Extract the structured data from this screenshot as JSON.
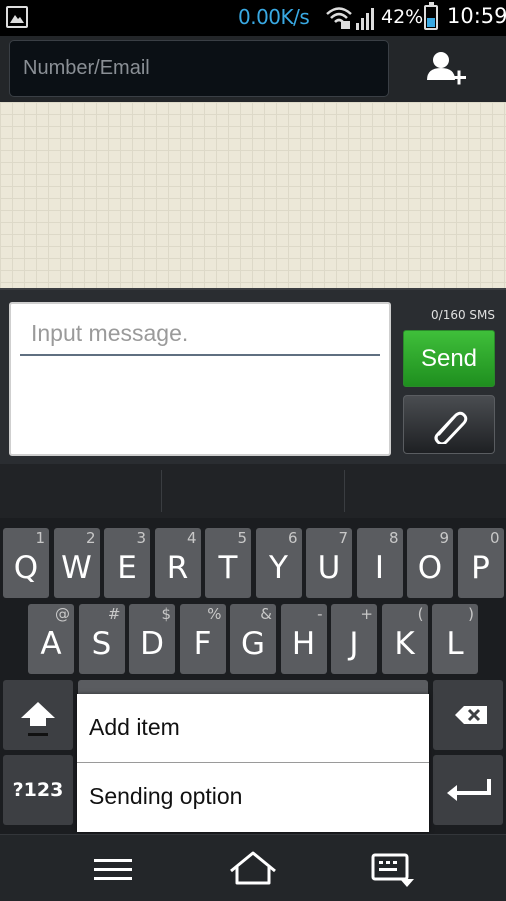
{
  "status_bar": {
    "network_speed": "0.00K/s",
    "battery_percent": "42%",
    "battery_level": 0.42,
    "time": "10:59",
    "icons": [
      "picture-icon",
      "wifi-icon",
      "signal-icon",
      "battery-icon"
    ]
  },
  "recipient": {
    "placeholder": "Number/Email",
    "add_contact_icon": "add-contact-icon"
  },
  "compose": {
    "placeholder": "Input message.",
    "counter": "0/160 SMS",
    "send_label": "Send",
    "attach_icon": "paperclip-icon"
  },
  "keyboard": {
    "row1": [
      {
        "main": "Q",
        "sub": "1"
      },
      {
        "main": "W",
        "sub": "2"
      },
      {
        "main": "E",
        "sub": "3"
      },
      {
        "main": "R",
        "sub": "4"
      },
      {
        "main": "T",
        "sub": "5"
      },
      {
        "main": "Y",
        "sub": "6"
      },
      {
        "main": "U",
        "sub": "7"
      },
      {
        "main": "I",
        "sub": "8"
      },
      {
        "main": "O",
        "sub": "9"
      },
      {
        "main": "P",
        "sub": "0"
      }
    ],
    "row2": [
      {
        "main": "A",
        "sub": "@"
      },
      {
        "main": "S",
        "sub": "#"
      },
      {
        "main": "D",
        "sub": "$"
      },
      {
        "main": "F",
        "sub": "%"
      },
      {
        "main": "G",
        "sub": "&"
      },
      {
        "main": "H",
        "sub": "-"
      },
      {
        "main": "J",
        "sub": "+"
      },
      {
        "main": "K",
        "sub": "("
      },
      {
        "main": "L",
        "sub": ")"
      }
    ],
    "symbols_label": "?123",
    "shift_icon": "shift-icon",
    "backspace_icon": "backspace-icon",
    "enter_icon": "enter-icon"
  },
  "popup_menu": {
    "items": [
      "Add item",
      "Sending option"
    ]
  },
  "nav_bar": {
    "icons": [
      "menu-icon",
      "home-icon",
      "keyboard-hide-icon"
    ]
  },
  "colors": {
    "accent": "#39a9e3",
    "send": "#2ea52b"
  }
}
